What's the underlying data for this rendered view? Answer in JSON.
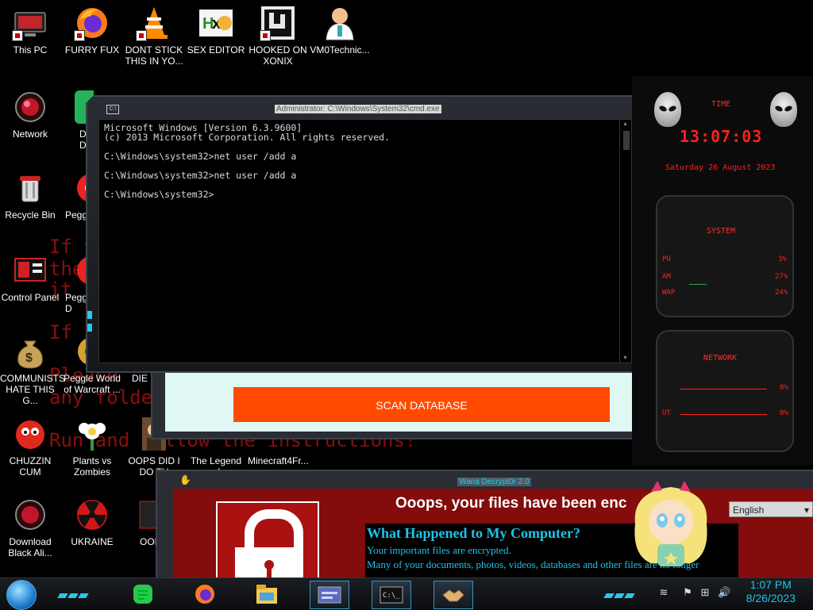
{
  "desktop": {
    "icons": [
      {
        "label": "This PC",
        "icon": "this-pc-icon"
      },
      {
        "label": "FURRY FUX",
        "icon": "firefox-icon"
      },
      {
        "label": "DONT STICK THIS IN YO...",
        "icon": "vlc-icon"
      },
      {
        "label": "SEX EDITOR",
        "icon": "hex-editor-icon"
      },
      {
        "label": "HOOKED ON XONIX",
        "icon": "xonix-icon"
      },
      {
        "label": "VM0Technic...",
        "icon": "doctor-icon"
      },
      {
        "label": "Network",
        "icon": "network-icon"
      },
      {
        "label": "D DU",
        "icon": "app-icon"
      },
      {
        "label": "Recycle Bin",
        "icon": "recycle-bin-icon"
      },
      {
        "label": "Peggl",
        "icon": "peggle-icon"
      },
      {
        "label": "Control Panel",
        "icon": "control-panel-icon"
      },
      {
        "label": "Peggl D",
        "icon": "peggle-icon"
      },
      {
        "label": "COMMUNISTS HATE THIS G...",
        "icon": "money-bag-icon"
      },
      {
        "label": "Peggle World of Warcraft ...",
        "icon": "peggle-icon"
      },
      {
        "label": "DIE",
        "icon": "app-icon"
      },
      {
        "label": "CHUZZIN CUM",
        "icon": "chuzzle-icon"
      },
      {
        "label": "Plants vs Zombies",
        "icon": "pvz-icon"
      },
      {
        "label": "OOPS DID I DO TH",
        "icon": "portrait-icon"
      },
      {
        "label": "The Legend of",
        "icon": "app-icon"
      },
      {
        "label": "Minecraft4Fr...",
        "icon": "minecraft-icon"
      },
      {
        "label": "Download Black Ali...",
        "icon": "network-icon"
      },
      {
        "label": "UKRAINE",
        "icon": "radiation-icon"
      },
      {
        "label": "OOF",
        "icon": "app-icon"
      }
    ],
    "background_text": [
      "If y",
      "the",
      "it",
      "If",
      "Please",
      "any folde",
      "Run and follow the instructions!"
    ]
  },
  "cmd": {
    "title": "Administrator: C:\\Windows\\System32\\cmd.exe",
    "output": "Microsoft Windows [Version 6.3.9600]\n(c) 2013 Microsoft Corporation. All rights reserved.\n\nC:\\Windows\\system32>net user /add a\n\nC:\\Windows\\system32>net user /add a\n\nC:\\Windows\\system32>"
  },
  "scan_window": {
    "button_label": "SCAN DATABASE"
  },
  "gadget": {
    "time_header": "TIME",
    "time": "13:07:03",
    "date": "Saturday 26 August 2023",
    "system_header": "SYSTEM",
    "system_rows": [
      {
        "label": "PU",
        "value": "3%"
      },
      {
        "label": "AM",
        "value": "27%"
      },
      {
        "label": "WAP",
        "value": "24%"
      }
    ],
    "network_header": "NETWORK",
    "network_rows": [
      {
        "label": "",
        "value": "0%"
      },
      {
        "label": "UT",
        "value": "0%"
      }
    ]
  },
  "wannacry": {
    "title": "Wana Decrypt0r 2.0",
    "headline": "Ooops, your files have been enc",
    "language": "English",
    "what_title": "What Happened to My Computer?",
    "line1": "Your important files are encrypted.",
    "line2": "Many of your documents, photos, videos, databases and other files are no longer"
  },
  "taskbar": {
    "time": "1:07 PM",
    "date": "8/26/2023",
    "apps": [
      "notes-icon",
      "firefox-icon",
      "file-explorer-icon",
      "window-icon",
      "cmd-icon",
      "handshake-icon"
    ]
  },
  "colors": {
    "accent": "#29c8e6",
    "gadget_red": "#ff2020",
    "wanna_red": "#830c0c",
    "scan_orange": "#ff4a00"
  }
}
